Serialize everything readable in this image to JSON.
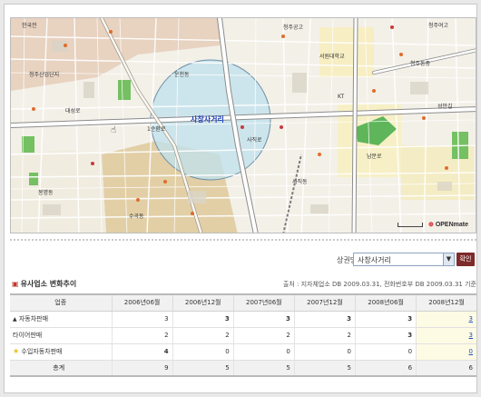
{
  "map": {
    "center_label": "사창사거리",
    "logo_prefix": "⊕",
    "logo_text": "OPENmate",
    "streets": [
      "한국전",
      "청주공고",
      "청주여고",
      "서원대학교",
      "청주동중",
      "KT",
      "사직로",
      "1순환로",
      "대성로",
      "청주산업단지",
      "남문로",
      "운천동",
      "사직동",
      "수곡동",
      "봉명동",
      "성안길"
    ],
    "cursor_icon": "hand-pointer-icon"
  },
  "search": {
    "label": "상권명",
    "selected": "사창사거리",
    "button": "확인"
  },
  "section": {
    "bullet_icon": "square-bullet-icon",
    "title": "유사업소 변화추이",
    "source": "출처 : 지자체업소 DB 2009.03.31, 전화번호부 DB 2009.03.31 기준"
  },
  "table": {
    "headers": [
      "업종",
      "2006년06월",
      "2006년12월",
      "2007년06월",
      "2007년12월",
      "2008년06월",
      "2008년12월"
    ],
    "rows": [
      {
        "marker": "▲",
        "name": "자동차판매",
        "values": [
          "3",
          "3",
          "3",
          "3",
          "3",
          "3"
        ]
      },
      {
        "marker": "",
        "name": "타이어판매",
        "values": [
          "2",
          "2",
          "2",
          "2",
          "3",
          "3"
        ]
      },
      {
        "marker": "★",
        "name": "수입자동차판매",
        "values": [
          "4",
          "0",
          "0",
          "0",
          "0",
          "0"
        ]
      }
    ],
    "total": {
      "name": "총계",
      "values": [
        "9",
        "5",
        "5",
        "5",
        "6",
        "6"
      ]
    }
  },
  "colors": {
    "accent": "#7d2b2b",
    "link": "#1f4fc1",
    "highlight": "#fdfbe4",
    "radius": "#bfe2ee"
  }
}
